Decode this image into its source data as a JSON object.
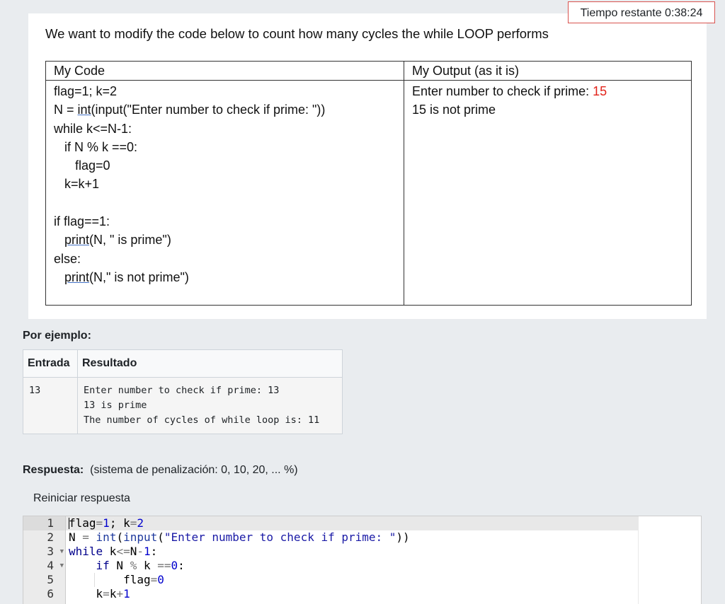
{
  "timer": {
    "label": "Tiempo restante 0:38:24"
  },
  "question": {
    "heading": "We want to modify the code below to count how many cycles the while LOOP performs",
    "table": {
      "col1_header": "My Code",
      "col2_header": "My Output (as it is)",
      "code_lines": [
        "flag=1; k=2",
        "N = int(input(\"Enter number to check if prime: \"))",
        "while k<=N-1:",
        "   if N % k ==0:",
        "      flag=0",
        "   k=k+1",
        "",
        "if flag==1:",
        "   print(N, \" is prime\")",
        "else:",
        "   print(N,\" is not prime\")"
      ],
      "output_lines": {
        "prompt": "Enter number to check if prime: ",
        "input_value": "15",
        "result": "15 is not prime"
      }
    }
  },
  "example": {
    "title": "Por ejemplo:",
    "col_input": "Entrada",
    "col_result": "Resultado",
    "input": "13",
    "result": "Enter number to check if prime: 13\n13 is prime\nThe number of cycles of while loop is: 11"
  },
  "answer": {
    "label": "Respuesta:",
    "penalty": "(sistema de penalización: 0, 10, 20, ... %)",
    "reset_label": "Reiniciar respuesta"
  },
  "editor": {
    "line_numbers": [
      "1",
      "2",
      "3",
      "4",
      "5",
      "6"
    ],
    "colors": {
      "keyword": "#00008b",
      "number": "#0000cd",
      "string": "#1a1aa6"
    }
  }
}
